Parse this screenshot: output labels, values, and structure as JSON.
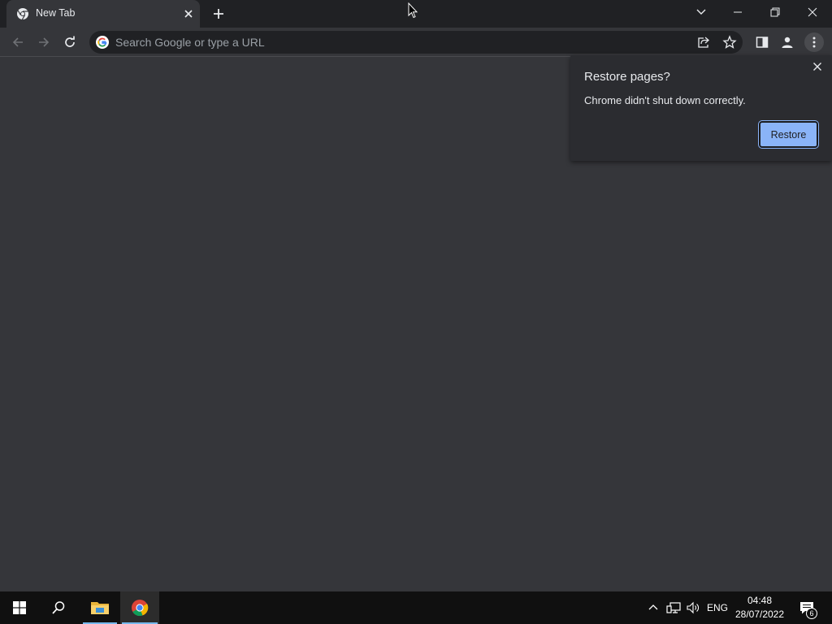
{
  "tab": {
    "title": "New Tab",
    "favicon": "chrome-icon",
    "close_icon": "close-icon"
  },
  "titlebar": {
    "new_tab_icon": "plus-icon",
    "tab_search_icon": "chevron-down-icon",
    "minimize_icon": "minimize-icon",
    "restore_icon": "restore-window-icon",
    "close_icon": "close-icon"
  },
  "toolbar": {
    "back_icon": "arrow-left-icon",
    "forward_icon": "arrow-right-icon",
    "reload_icon": "reload-icon",
    "omnibox_placeholder": "Search Google or type a URL",
    "share_icon": "share-icon",
    "bookmark_icon": "star-icon",
    "side_panel_icon": "side-panel-icon",
    "profile_icon": "person-icon",
    "menu_icon": "kebab-menu-icon"
  },
  "restore_popup": {
    "title": "Restore pages?",
    "message": "Chrome didn't shut down correctly.",
    "button_label": "Restore",
    "close_icon": "close-icon"
  },
  "taskbar": {
    "start_icon": "windows-icon",
    "search_icon": "search-icon",
    "apps": [
      {
        "name": "File Explorer",
        "icon": "folder-icon"
      },
      {
        "name": "Google Chrome",
        "icon": "chrome-icon"
      }
    ],
    "tray": {
      "chevron_icon": "chevron-up-icon",
      "network_icon": "network-icon",
      "volume_icon": "volume-icon",
      "language": "ENG",
      "time": "04:48",
      "date": "28/07/2022",
      "notifications_icon": "notification-icon",
      "notifications_count": "6"
    }
  },
  "colors": {
    "titlebar": "#202124",
    "toolbar": "#35363a",
    "page": "#35363a",
    "accent": "#8ab4f8",
    "taskbar": "#101010"
  }
}
